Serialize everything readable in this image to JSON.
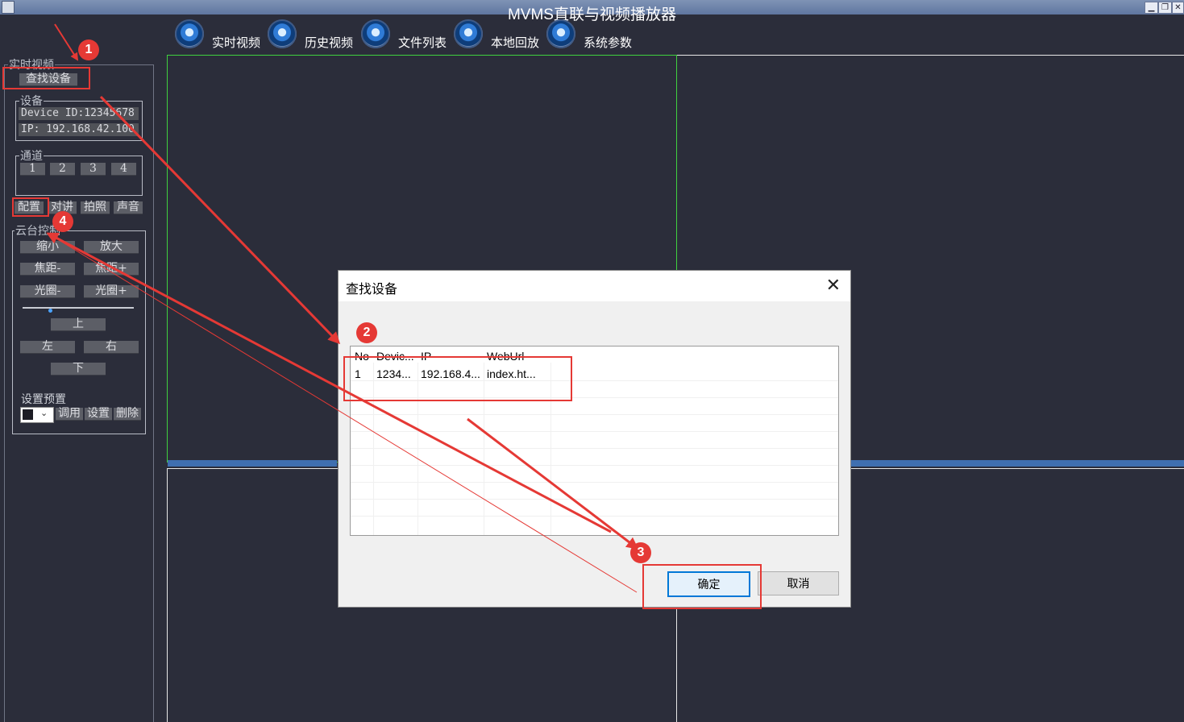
{
  "app": {
    "title": "MVMS直联与视频播放器",
    "min": "▁",
    "restore": "❐",
    "close": "✕"
  },
  "toolbar": [
    {
      "label": "实时视频",
      "icon": "camera-icon"
    },
    {
      "label": "历史视频",
      "icon": "history-icon"
    },
    {
      "label": "文件列表",
      "icon": "file-list-icon"
    },
    {
      "label": "本地回放",
      "icon": "playback-icon"
    },
    {
      "label": "系统参数",
      "icon": "settings-icon"
    }
  ],
  "left": {
    "section_title": "实时视频",
    "find_device": "查找设备",
    "device": {
      "title": "设备",
      "id_text": "Device ID:12345678",
      "ip_text": "IP: 192.168.42.100"
    },
    "channel": {
      "title": "通道",
      "buttons": [
        "1",
        "2",
        "3",
        "4"
      ]
    },
    "actions": [
      "配置",
      "对讲",
      "拍照",
      "声音"
    ],
    "ptz": {
      "title": "云台控制",
      "zoom_out": "缩小",
      "zoom_in": "放大",
      "focus_minus": "焦距-",
      "focus_plus": "焦距+",
      "iris_minus": "光圈-",
      "iris_plus": "光圈+",
      "speed_level": 0.25,
      "up": "上",
      "left": "左",
      "right": "右",
      "down": "下"
    },
    "preset": {
      "title": "设置预置",
      "call": "调用",
      "set": "设置",
      "delete": "删除"
    }
  },
  "dialog": {
    "title": "查找设备",
    "close": "✕",
    "columns": [
      "No",
      "Devic...",
      "IP",
      "WebUrl"
    ],
    "rows": [
      [
        "1",
        "1234...",
        "192.168.4...",
        "index.ht..."
      ]
    ],
    "ok": "确定",
    "cancel": "取消"
  },
  "annotations": {
    "badge1": "1",
    "badge2": "2",
    "badge3": "3",
    "badge4": "4",
    "color": "#e53935"
  }
}
